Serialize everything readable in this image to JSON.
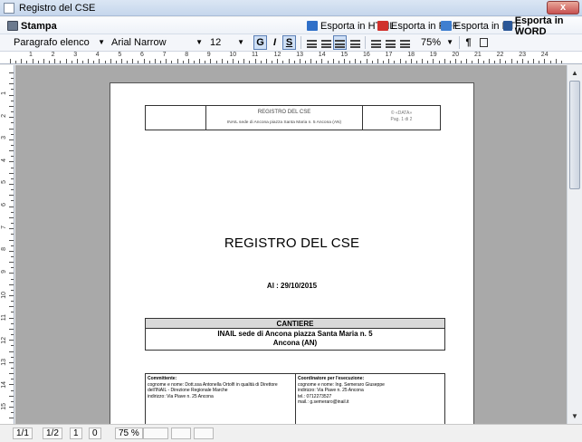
{
  "window": {
    "title": "Registro del CSE",
    "close_label": "x"
  },
  "toolbar": {
    "print_label": "Stampa",
    "export_html_label": "Esporta in HTML",
    "export_pdf_label": "Esporta in PDF",
    "export_rtf_label": "Esporta in RTF",
    "export_word_label": "Esporta in WORD"
  },
  "format": {
    "style": "Paragrafo elenco",
    "font": "Arial Narrow",
    "size": "12",
    "bold": "G",
    "italic": "I",
    "underline": "S",
    "zoom": "75%",
    "pilcrow": "¶"
  },
  "ruler": {
    "numbers": [
      "1",
      "2",
      "3",
      "4",
      "5",
      "6",
      "7",
      "8",
      "9",
      "10",
      "11",
      "12",
      "13",
      "14",
      "15",
      "16",
      "17",
      "18",
      "19",
      "20",
      "21",
      "22",
      "23",
      "24"
    ]
  },
  "vruler": {
    "numbers": [
      "1",
      "2",
      "3",
      "4",
      "5",
      "6",
      "7",
      "8",
      "9",
      "10",
      "11",
      "12",
      "13",
      "14",
      "15"
    ]
  },
  "document": {
    "header": {
      "center_title": "REGISTRO DEL CSE",
      "center_subtitle": "INAIL sede di Ancona piazza Santa Maria n. 5 Ancona (AN)",
      "right_line1": "© «DATA»",
      "right_line2": "Pag. 1 di 2"
    },
    "title": "REGISTRO DEL CSE",
    "date_line": "Al : 29/10/2015",
    "cantiere": {
      "heading": "CANTIERE",
      "line1": "INAIL sede di Ancona piazza Santa Maria n. 5",
      "line2": "Ancona (AN)"
    },
    "committente": {
      "label": "Committente:",
      "lines": [
        "cognome e nome: Dott.ssa Antonella Ortolfi in qualità di Direttore",
        "dell'INAIL - Direzione Regionale Marche",
        "indirizzo: Via Piave n. 25 Ancona"
      ]
    },
    "coordinatore": {
      "label": "Coordinatore per l'esecuzione:",
      "lines": [
        "cognome e nome: Ing. Semeraro Giuseppe",
        "indirizzo: Via Piave n. 25 Ancona",
        "tel.: 0712273527",
        "mail.: g.semeraro@inail.it"
      ]
    }
  },
  "status": {
    "page": "1/1",
    "section": "1/2",
    "line": "1",
    "col": "0",
    "zoom": "75 %"
  }
}
